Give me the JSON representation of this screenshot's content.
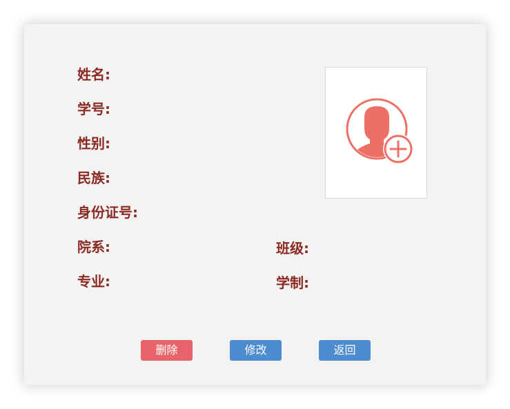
{
  "form": {
    "name_label": "姓名:",
    "student_id_label": "学号:",
    "gender_label": "性别:",
    "ethnicity_label": "民族:",
    "id_number_label": "身份证号:",
    "department_label": "院系:",
    "class_label": "班级:",
    "major_label": "专业:",
    "program_length_label": "学制:"
  },
  "photo": {
    "icon": "add-avatar-icon",
    "accent_color": "#ee6f65"
  },
  "buttons": {
    "delete_label": "删除",
    "modify_label": "修改",
    "back_label": "返回"
  },
  "colors": {
    "label_text": "#8a2a22",
    "delete_button": "#e8646a",
    "modify_button": "#4d8ccf",
    "back_button": "#4d8ccf",
    "card_background": "#f3f3f3"
  }
}
